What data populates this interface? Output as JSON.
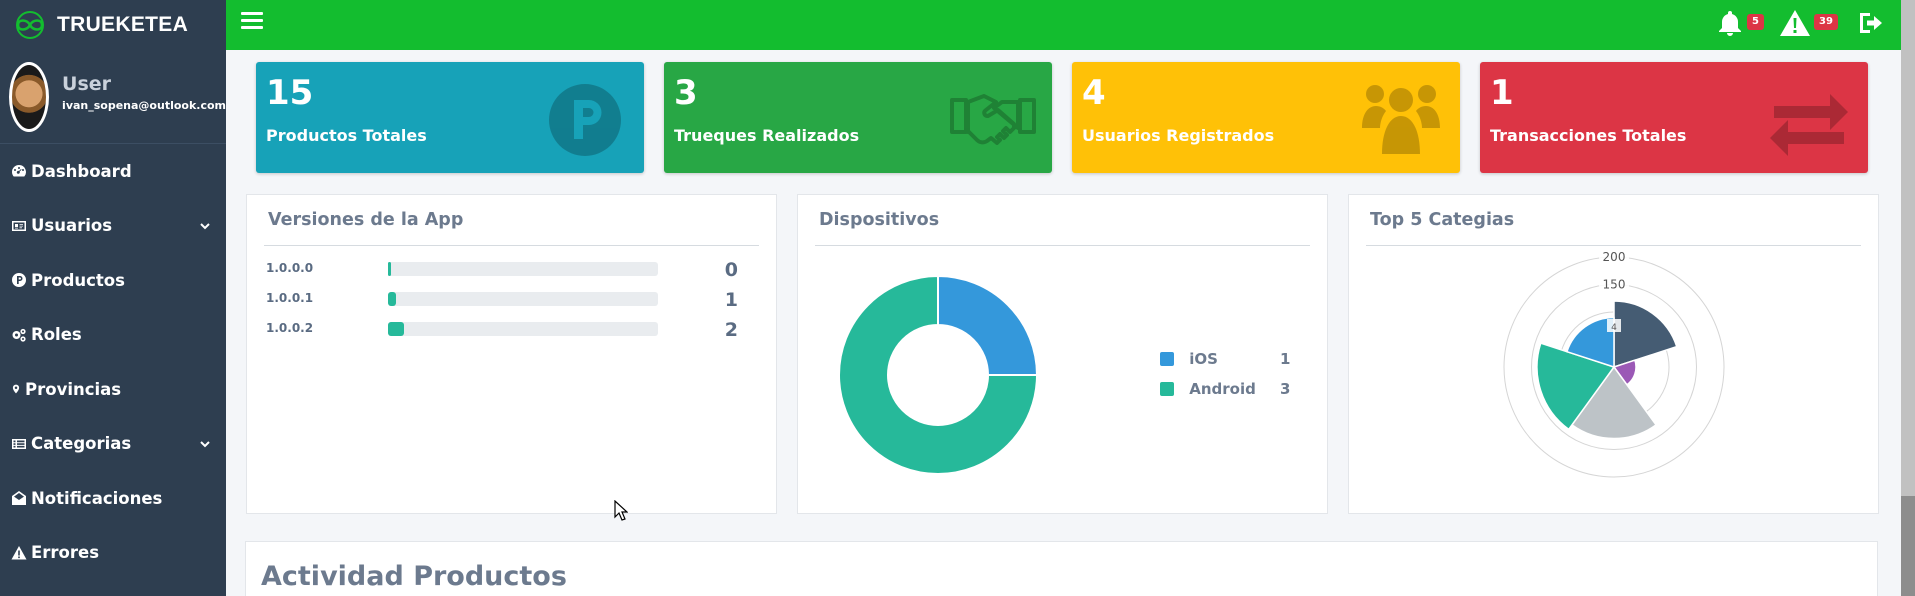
{
  "brand": {
    "name": "TRUEKETEA",
    "color": "#13bd2f"
  },
  "user": {
    "name": "User",
    "email": "ivan_sopena@outlook.com"
  },
  "sidebar": {
    "items": [
      {
        "label": "Dashboard",
        "icon": "dashboard-icon"
      },
      {
        "label": "Usuarios",
        "icon": "id-card-icon",
        "expandable": true
      },
      {
        "label": "Productos",
        "icon": "product-p-icon"
      },
      {
        "label": "Roles",
        "icon": "gears-icon"
      },
      {
        "label": "Provincias",
        "icon": "map-marker-icon"
      },
      {
        "label": "Categorias",
        "icon": "list-icon",
        "expandable": true
      },
      {
        "label": "Notificaciones",
        "icon": "envelope-open-icon"
      },
      {
        "label": "Errores",
        "icon": "warning-icon"
      }
    ]
  },
  "topbar": {
    "notifications_count": "5",
    "alerts_count": "39"
  },
  "stats": [
    {
      "value": "15",
      "label": "Productos Totales",
      "color": "#17a2b8",
      "icon": "product-p-icon"
    },
    {
      "value": "3",
      "label": "Trueques Realizados",
      "color": "#28a745",
      "icon": "handshake-icon"
    },
    {
      "value": "4",
      "label": "Usuarios Registrados",
      "color": "#ffc107",
      "icon": "users-icon"
    },
    {
      "value": "1",
      "label": "Transacciones Totales",
      "color": "#dc3545",
      "icon": "exchange-arrows-icon"
    }
  ],
  "versions": {
    "title": "Versiones de la App",
    "rows": [
      {
        "name": "1.0.0.0",
        "count": "0",
        "fraction": 0.01
      },
      {
        "name": "1.0.0.1",
        "count": "1",
        "fraction": 0.03
      },
      {
        "name": "1.0.0.2",
        "count": "2",
        "fraction": 0.06
      }
    ]
  },
  "devices": {
    "title": "Dispositivos",
    "legend": [
      {
        "label": "iOS",
        "value": "1",
        "color": "#3498db"
      },
      {
        "label": "Android",
        "value": "3",
        "color": "#26b99a"
      }
    ]
  },
  "categories": {
    "title": "Top 5 Categias",
    "tick_labels": [
      "200",
      "150",
      "4"
    ]
  },
  "activity": {
    "title": "Actividad Productos"
  },
  "chart_data": [
    {
      "type": "pie",
      "title": "Dispositivos",
      "categories": [
        "iOS",
        "Android"
      ],
      "values": [
        1,
        3
      ],
      "colors": [
        "#3498db",
        "#26b99a"
      ],
      "donut": true
    },
    {
      "type": "polarArea",
      "title": "Top 5 Categias",
      "values": [
        120,
        40,
        130,
        140,
        90
      ],
      "colors": [
        "#455c73",
        "#9b59b6",
        "#bdc3c7",
        "#26b99a",
        "#3498db"
      ],
      "rlim": [
        0,
        200
      ],
      "ticks": [
        150,
        200
      ]
    }
  ]
}
